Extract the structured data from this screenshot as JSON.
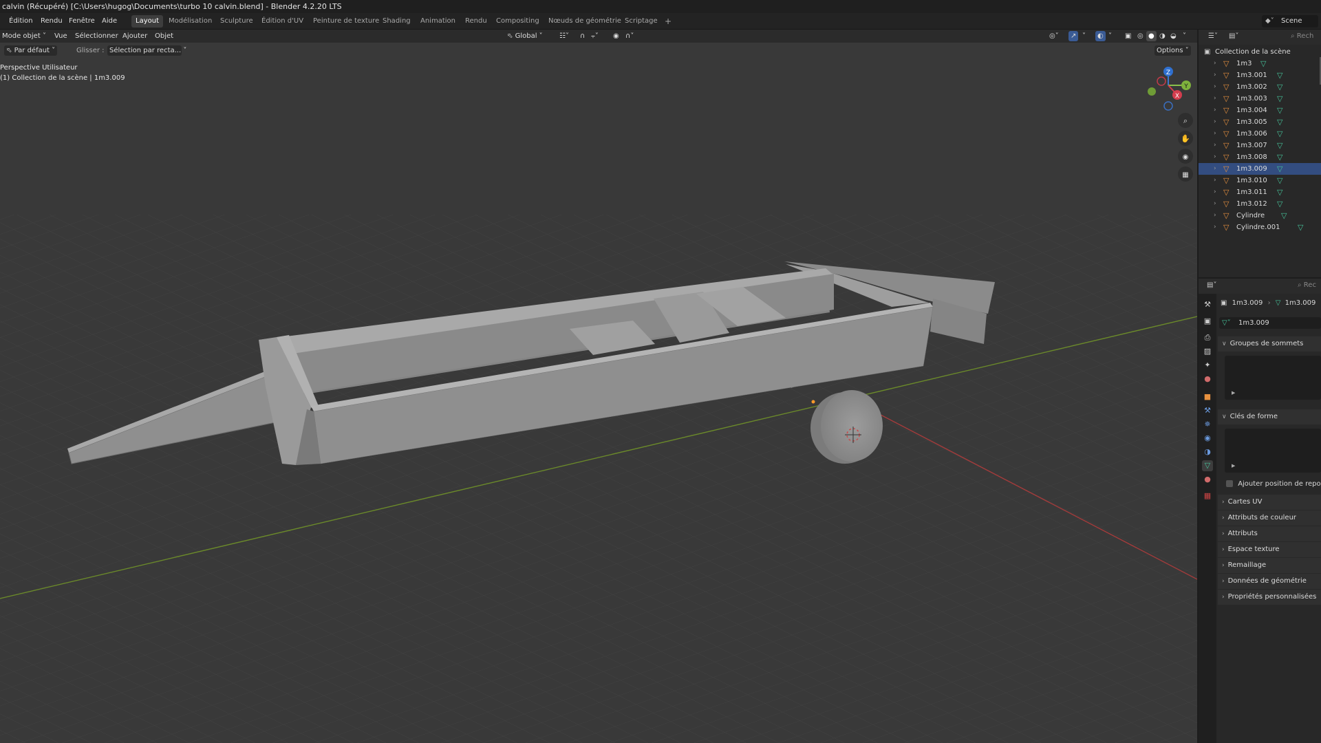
{
  "window_title": "calvin (Récupéré) [C:\\Users\\hugog\\Documents\\turbo 10 calvin.blend] - Blender 4.2.20 LTS",
  "menu": [
    "Édition",
    "Rendu",
    "Fenêtre",
    "Aide"
  ],
  "workspaces": [
    "Layout",
    "Modélisation",
    "Sculpture",
    "Édition d'UV",
    "Peinture de texture",
    "Shading",
    "Animation",
    "Rendu",
    "Compositing",
    "Nœuds de géométrie",
    "Scriptage"
  ],
  "add_workspace": "+",
  "scene_name": "Scene",
  "viewport_header": {
    "mode": "Mode objet",
    "menus": [
      "Vue",
      "Sélectionner",
      "Ajouter",
      "Objet"
    ],
    "orientation": "Global",
    "options": "Options"
  },
  "tool_header": {
    "orientation": "Par défaut",
    "drag_label": "Glisser :",
    "drag_value": "Sélection par recta..."
  },
  "overlay": {
    "view_name": "Perspective Utilisateur",
    "collection_info": "(1) Collection de la scène | 1m3.009"
  },
  "gizmo": {
    "x": "X",
    "y": "Y",
    "z": "Z"
  },
  "outliner": {
    "search_placeholder": "Rech",
    "collection": "Collection de la scène",
    "items": [
      {
        "name": "1m3",
        "selected": false
      },
      {
        "name": "1m3.001",
        "selected": false
      },
      {
        "name": "1m3.002",
        "selected": false
      },
      {
        "name": "1m3.003",
        "selected": false
      },
      {
        "name": "1m3.004",
        "selected": false
      },
      {
        "name": "1m3.005",
        "selected": false
      },
      {
        "name": "1m3.006",
        "selected": false
      },
      {
        "name": "1m3.007",
        "selected": false
      },
      {
        "name": "1m3.008",
        "selected": false
      },
      {
        "name": "1m3.009",
        "selected": true
      },
      {
        "name": "1m3.010",
        "selected": false
      },
      {
        "name": "1m3.011",
        "selected": false
      },
      {
        "name": "1m3.012",
        "selected": false
      },
      {
        "name": "Cylindre",
        "selected": false
      },
      {
        "name": "Cylindre.001",
        "selected": false
      }
    ]
  },
  "properties": {
    "search_placeholder": "Rec",
    "breadcrumb_object": "1m3.009",
    "breadcrumb_mesh": "1m3.009",
    "mesh_name": "1m3.009",
    "panels": {
      "vertex_groups": "Groupes de sommets",
      "shape_keys": "Clés de forme",
      "add_rest_position": "Ajouter position de repos",
      "uv_maps": "Cartes UV",
      "color_attributes": "Attributs de couleur",
      "attributes": "Attributs",
      "texture_space": "Espace texture",
      "remesh": "Remaillage",
      "geometry_data": "Données de géométrie",
      "custom_properties": "Propriétés personnalisées"
    }
  },
  "colors": {
    "accent": "#4772b3",
    "selected_row": "#334d80",
    "object_icon": "#e8913f",
    "mesh_icon": "#46c39a",
    "axis_x": "#ff3352",
    "axis_y": "#8bdc00",
    "axis_z": "#2890ff"
  }
}
